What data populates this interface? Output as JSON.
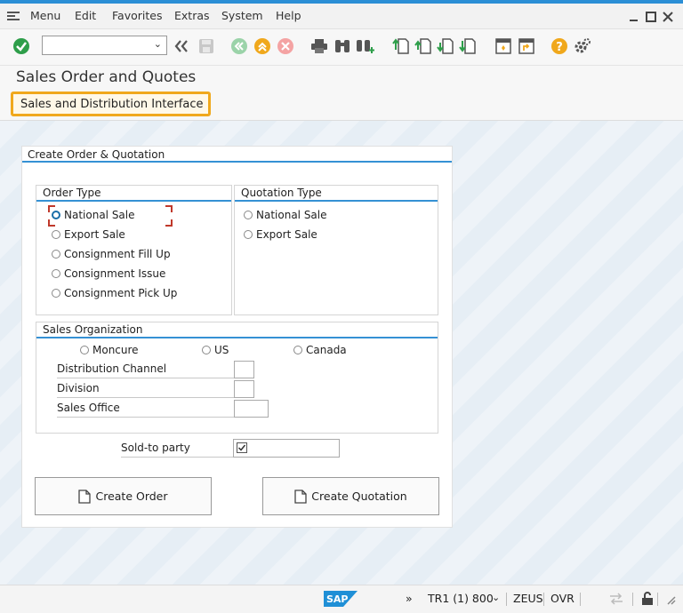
{
  "menubar": {
    "items": [
      "Menu",
      "Edit",
      "Favorites",
      "Extras",
      "System",
      "Help"
    ]
  },
  "toolbar": {
    "command_field_value": ""
  },
  "title": "Sales Order and Quotes",
  "appbar": {
    "sdi_label": "Sales and Distribution Interface"
  },
  "form": {
    "group_title": "Create Order & Quotation",
    "order_type": {
      "title": "Order Type",
      "options": [
        "National Sale",
        "Export Sale",
        "Consignment Fill Up",
        "Consignment Issue",
        "Consignment Pick Up"
      ],
      "selected": "National Sale"
    },
    "quotation_type": {
      "title": "Quotation Type",
      "options": [
        "National Sale",
        "Export Sale"
      ]
    },
    "sales_org": {
      "title": "Sales Organization",
      "options": [
        "Moncure",
        "US",
        "Canada"
      ],
      "fields": {
        "distribution_channel": "Distribution Channel",
        "division": "Division",
        "sales_office": "Sales Office"
      }
    },
    "sold_to_label": "Sold-to party",
    "create_order_label": "Create Order",
    "create_quotation_label": "Create Quotation"
  },
  "status": {
    "system": "TR1 (1) 800",
    "server": "ZEUS",
    "mode": "OVR"
  },
  "colors": {
    "accent": "#3591d4",
    "highlight": "#f0a81c",
    "ok_green": "#2e9e4a"
  }
}
